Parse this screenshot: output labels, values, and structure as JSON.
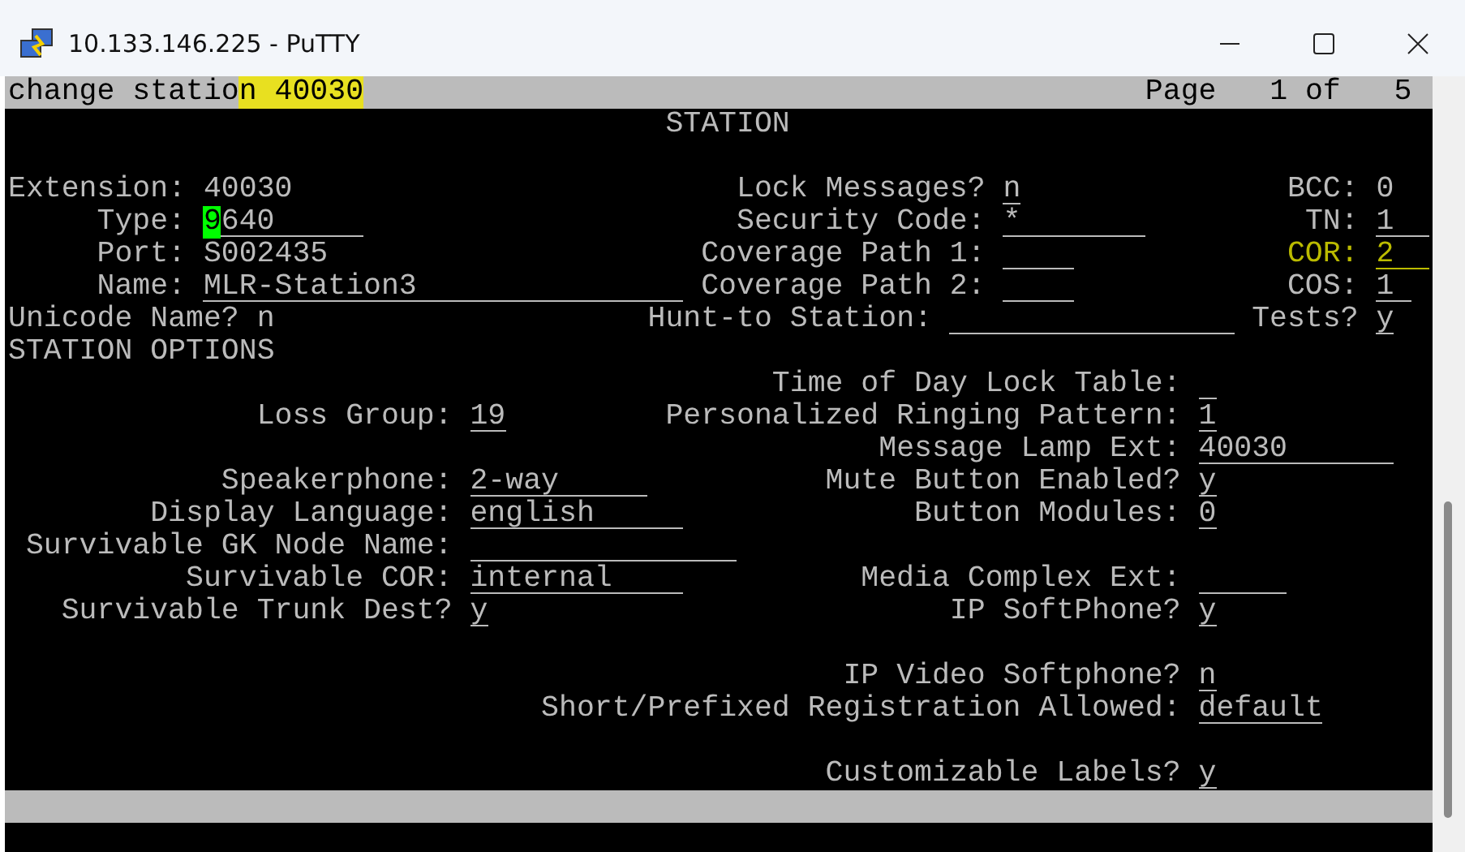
{
  "window": {
    "title": "10.133.146.225 - PuTTY"
  },
  "command_line": [
    {
      "text": "change statio",
      "highlighted": false
    },
    {
      "text": "n 40030",
      "highlighted": true
    }
  ],
  "page": {
    "label": "Page",
    "position": "1 of",
    "total": "5"
  },
  "title": "STATION",
  "section": "STATION OPTIONS",
  "fields": [
    {
      "label": "Extension:",
      "value": "40030",
      "underlined": false
    },
    {
      "label": "Lock Messages?",
      "value": "n",
      "underlined": true
    },
    {
      "label": "BCC:",
      "value": "0",
      "underlined": false
    },
    {
      "label": "Type:",
      "value": "9640",
      "underlined": true,
      "cursor": true
    },
    {
      "label": "Security Code:",
      "value": "*",
      "underlined": true
    },
    {
      "label": "TN:",
      "value": "1",
      "underlined": true
    },
    {
      "label": "Port:",
      "value": "S002435",
      "underlined": false
    },
    {
      "label": "Coverage Path 1:",
      "underlined": true
    },
    {
      "label": "COR:",
      "value": "2",
      "underlined": true,
      "emphasized": true
    },
    {
      "label": "Name:",
      "value": "MLR-Station3",
      "underlined": true
    },
    {
      "label": "Coverage Path 2:",
      "underlined": true
    },
    {
      "label": "COS:",
      "value": "1",
      "underlined": true
    },
    {
      "label": "Unicode Name?",
      "value": "n",
      "underlined": false
    },
    {
      "label": "Hunt-to Station:",
      "underlined": true
    },
    {
      "label": "Tests?",
      "value": "y",
      "underlined": true
    },
    {
      "label": "Time of Day Lock Table:",
      "underlined": true
    },
    {
      "label": "Loss Group:",
      "value": "19",
      "underlined": true
    },
    {
      "label": "Personalized Ringing Pattern:",
      "value": "1",
      "underlined": true
    },
    {
      "label": "Message Lamp Ext:",
      "value": "40030",
      "underlined": true
    },
    {
      "label": "Speakerphone:",
      "value": "2-way",
      "underlined": true
    },
    {
      "label": "Mute Button Enabled?",
      "value": "y",
      "underlined": true
    },
    {
      "label": "Display Language:",
      "value": "english",
      "underlined": true
    },
    {
      "label": "Button Modules:",
      "value": "0",
      "underlined": true
    },
    {
      "label": "Survivable GK Node Name:",
      "underlined": true
    },
    {
      "label": "Survivable COR:",
      "value": "internal",
      "underlined": true
    },
    {
      "label": "Media Complex Ext:",
      "underlined": true
    },
    {
      "label": "Survivable Trunk Dest?",
      "value": "y",
      "underlined": true
    },
    {
      "label": "IP SoftPhone?",
      "value": "y",
      "underlined": true
    },
    {
      "label": "IP Video Softphone?",
      "value": "n",
      "underlined": true
    },
    {
      "label": "Short/Prefixed Registration Allowed:",
      "value": "default",
      "underlined": true
    },
    {
      "label": "Customizable Labels?",
      "value": "y",
      "underlined": true
    }
  ]
}
